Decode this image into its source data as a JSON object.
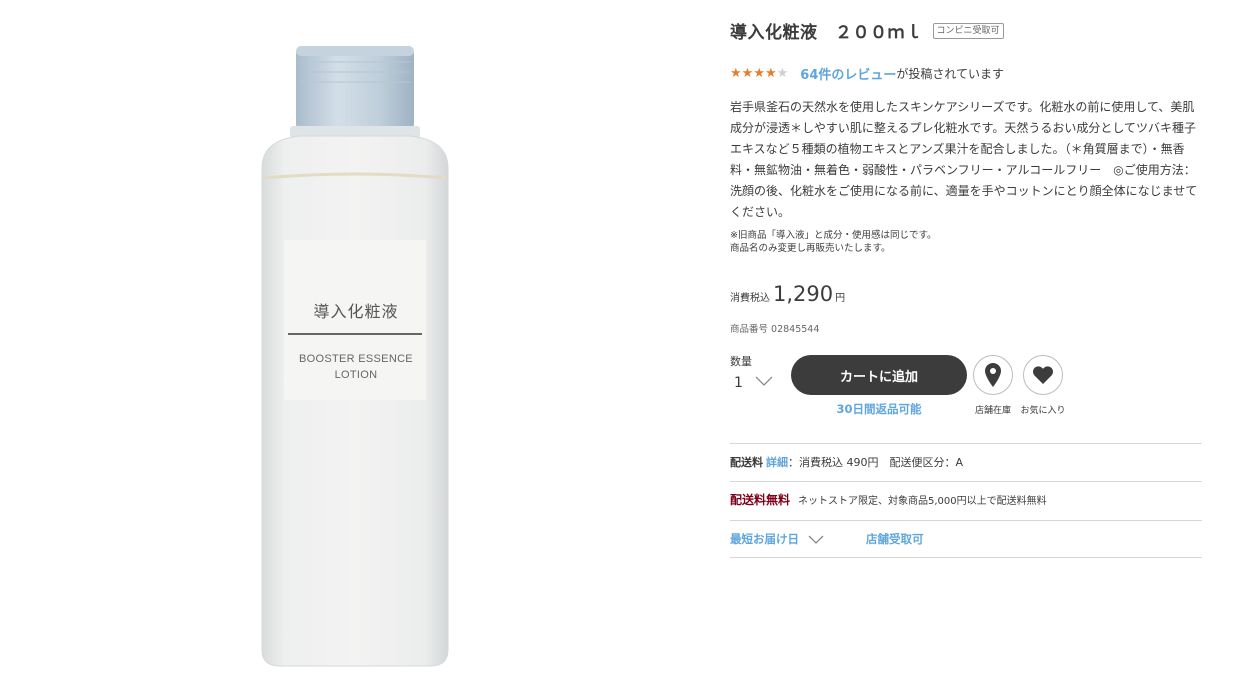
{
  "product": {
    "title": "導入化粧液　２００ｍｌ",
    "badge": "コンビニ受取可",
    "rating": {
      "score": 4,
      "max": 5
    },
    "review_link": "64件のレビュー",
    "review_suffix": "が投稿されています",
    "description": "岩手県釜石の天然水を使用したスキンケアシリーズです。化粧水の前に使用して、美肌成分が浸透＊しやすい肌に整えるプレ化粧水です。天然うるおい成分としてツバキ種子エキスなど５種類の植物エキスとアンズ果汁を配合しました。（＊角質層まで）・無香料・無鉱物油・無着色・弱酸性・パラベンフリー・アルコールフリー　◎ご使用方法：洗顔の後、化粧水をご使用になる前に、適量を手やコットンにとり顔全体になじませてください。",
    "note_line1": "※旧商品「導入液」と成分・使用感は同じです。",
    "note_line2": "商品名のみ変更し再販売いたします。",
    "price_label": "消費税込",
    "price": "1,290",
    "price_unit": "円",
    "product_number": "商品番号  02845544"
  },
  "bottle_label": {
    "title": "導入化粧液",
    "line1": "BOOSTER ESSENCE",
    "line2": "LOTION"
  },
  "purchase": {
    "qty_label": "数量",
    "qty_value": "1",
    "cart_button": "カートに追加",
    "return_note": "30日間返品可能",
    "store_stock_caption": "店舗在庫",
    "favorite_caption": "お気に入り"
  },
  "shipping": {
    "label": "配送料",
    "detail_link": "詳細",
    "detail_text": "：消費税込 490円　配送便区分：A",
    "free_label": "配送料無料",
    "free_desc": "ネットストア限定、対象商品5,000円以上で配送料無料",
    "delivery_link": "最短お届け日",
    "pickup": "店舗受取可"
  },
  "colors": {
    "accent_link": "#5fa6de",
    "star_on": "#e87d2c",
    "free_shipping": "#7f0019",
    "button_dark": "#3c3c3c"
  },
  "icons": [
    "chevron-down-icon",
    "map-pin-icon",
    "heart-icon",
    "star-icon"
  ]
}
